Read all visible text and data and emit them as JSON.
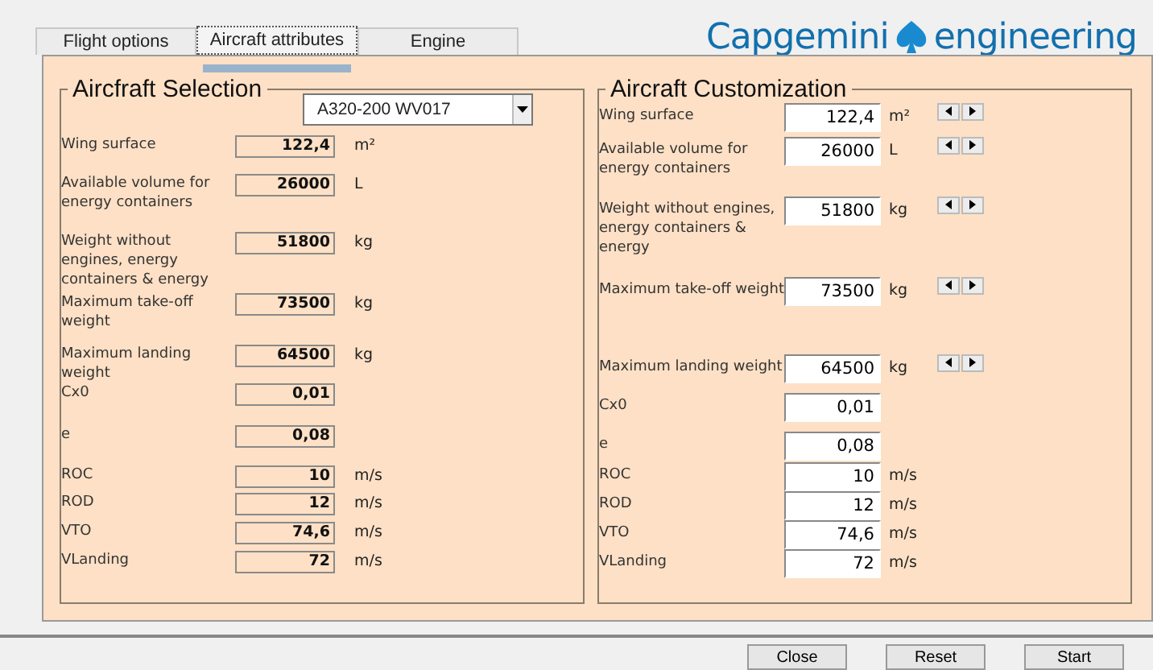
{
  "tabs": [
    {
      "label": "Flight options",
      "selected": false
    },
    {
      "label": "Aircraft attributes",
      "selected": true
    },
    {
      "label": "Engine",
      "selected": false
    }
  ],
  "logo": {
    "brand": "Capgemini",
    "suffix": "engineering"
  },
  "selection": {
    "title": "Aircfraft Selection",
    "aircraft": "A320-200 WV017",
    "rows": [
      {
        "label": "Wing surface",
        "value": "122,4",
        "unit": "m²"
      },
      {
        "label": "Available volume for energy containers",
        "value": "26000",
        "unit": "L"
      },
      {
        "label": "Weight without engines, energy containers & energy",
        "value": "51800",
        "unit": "kg"
      },
      {
        "label": "Maximum take-off weight",
        "value": "73500",
        "unit": "kg"
      },
      {
        "label": "Maximum landing weight",
        "value": "64500",
        "unit": "kg"
      },
      {
        "label": "Cx0",
        "value": "0,01"
      },
      {
        "label": "e",
        "value": "0,08"
      },
      {
        "label": "ROC",
        "value": "10",
        "unit": "m/s"
      },
      {
        "label": "ROD",
        "value": "12",
        "unit": "m/s"
      },
      {
        "label": "VTO",
        "value": "74,6",
        "unit": "m/s"
      },
      {
        "label": "VLanding",
        "value": "72",
        "unit": "m/s"
      }
    ]
  },
  "customization": {
    "title": "Aircraft Customization",
    "rows": [
      {
        "label": "Wing surface",
        "value": "122,4",
        "unit": "m²",
        "spinner": true
      },
      {
        "label": "Available volume for energy containers",
        "value": "26000",
        "unit": "L",
        "spinner": true
      },
      {
        "label": "Weight without engines, energy containers & energy",
        "value": "51800",
        "unit": "kg",
        "spinner": true
      },
      {
        "label": "Maximum take-off weight",
        "value": "73500",
        "unit": "kg",
        "spinner": true
      },
      {
        "label": "Maximum landing weight",
        "value": "64500",
        "unit": "kg",
        "spinner": true
      },
      {
        "label": "Cx0",
        "value": "0,01",
        "spinner": false
      },
      {
        "label": "e",
        "value": "0,08",
        "spinner": false
      },
      {
        "label": "ROC",
        "value": "10",
        "unit": "m/s",
        "spinner": false
      },
      {
        "label": "ROD",
        "value": "12",
        "unit": "m/s",
        "spinner": false
      },
      {
        "label": "VTO",
        "value": "74,6",
        "unit": "m/s",
        "spinner": false
      },
      {
        "label": "VLanding",
        "value": "72",
        "unit": "m/s",
        "spinner": false
      }
    ]
  },
  "buttons": [
    "Close",
    "Reset",
    "Start"
  ]
}
